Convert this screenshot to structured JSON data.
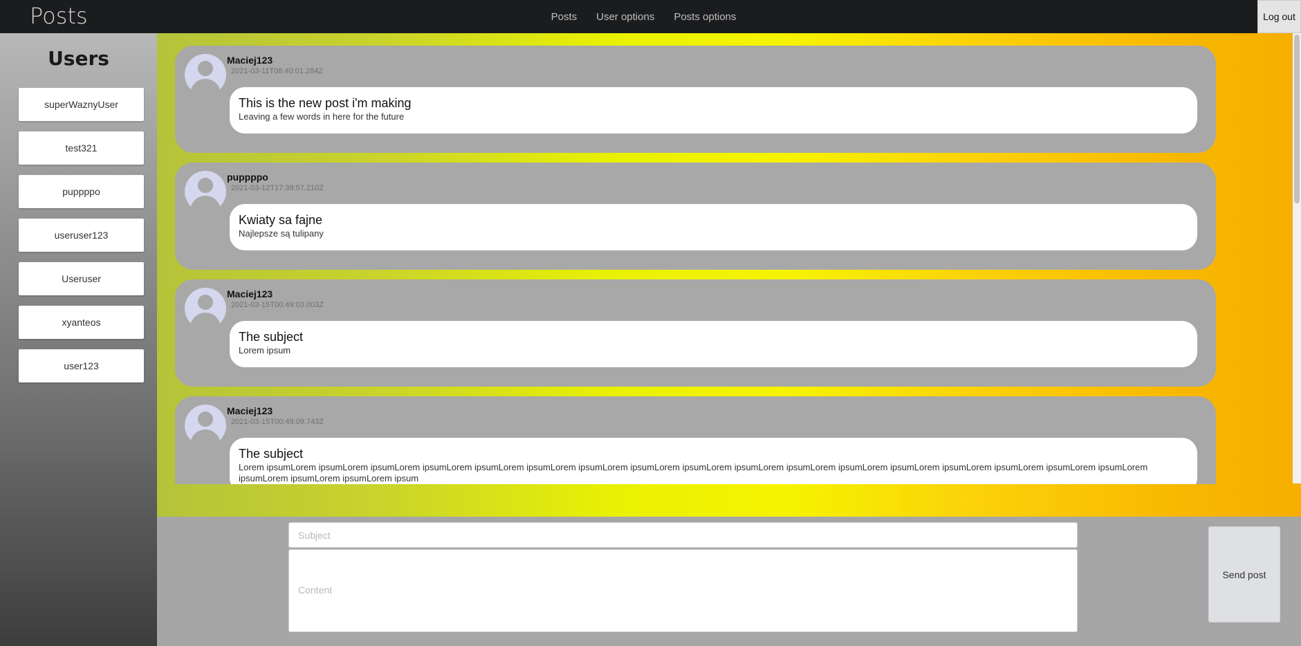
{
  "header": {
    "brand": "Posts",
    "nav": [
      "Posts",
      "User options",
      "Posts options"
    ],
    "logout_label": "Log out"
  },
  "sidebar": {
    "title": "Users",
    "users": [
      "superWaznyUser",
      "test321",
      "puppppo",
      "useruser123",
      "Useruser",
      "xyanteos",
      "user123"
    ]
  },
  "posts": [
    {
      "author": "Maciej123",
      "date": "2021-03-11T08:40:01.284Z",
      "subject": "This is the new post i'm making",
      "content": "Leaving a few words in here for the future"
    },
    {
      "author": "puppppo",
      "date": "2021-03-12T17:39:57.210Z",
      "subject": "Kwiaty sa fajne",
      "content": "Najlepsze są tulipany"
    },
    {
      "author": "Maciej123",
      "date": "2021-03-15T00:49:03.003Z",
      "subject": "The subject",
      "content": "Lorem ipsum"
    },
    {
      "author": "Maciej123",
      "date": "2021-03-15T00:49:09.743Z",
      "subject": "The subject",
      "content": "Lorem ipsumLorem ipsumLorem ipsumLorem ipsumLorem ipsumLorem ipsumLorem ipsumLorem ipsumLorem ipsumLorem ipsumLorem ipsumLorem ipsumLorem ipsumLorem ipsumLorem ipsumLorem ipsumLorem ipsumLorem ipsumLorem ipsumLorem ipsumLorem ipsum"
    }
  ],
  "compose": {
    "subject_placeholder": "Subject",
    "content_placeholder": "Content",
    "send_label": "Send post"
  },
  "colors": {
    "navbar": "#1b1c1e",
    "post_bubble": "#a8a8a8",
    "avatar_bg": "#d4d7ed",
    "gradient_start": "#b5c33a",
    "gradient_mid": "#f6f300",
    "gradient_end": "#f6ae00"
  }
}
